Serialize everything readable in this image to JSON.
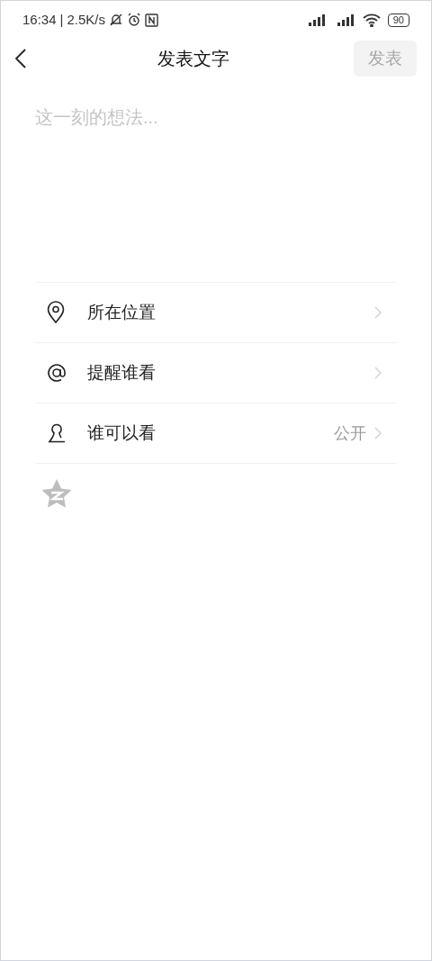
{
  "status_bar": {
    "time": "16:34",
    "separator": "|",
    "speed": "2.5K/s",
    "battery": "90"
  },
  "header": {
    "title": "发表文字",
    "publish_button": {
      "label": "发表",
      "disabled": true
    }
  },
  "editor": {
    "placeholder": "这一刻的想法..."
  },
  "options": [
    {
      "kind": "location",
      "label": "所在位置"
    },
    {
      "kind": "mention",
      "label": "提醒谁看"
    },
    {
      "kind": "visibility",
      "label": "谁可以看",
      "value": "公开"
    }
  ]
}
